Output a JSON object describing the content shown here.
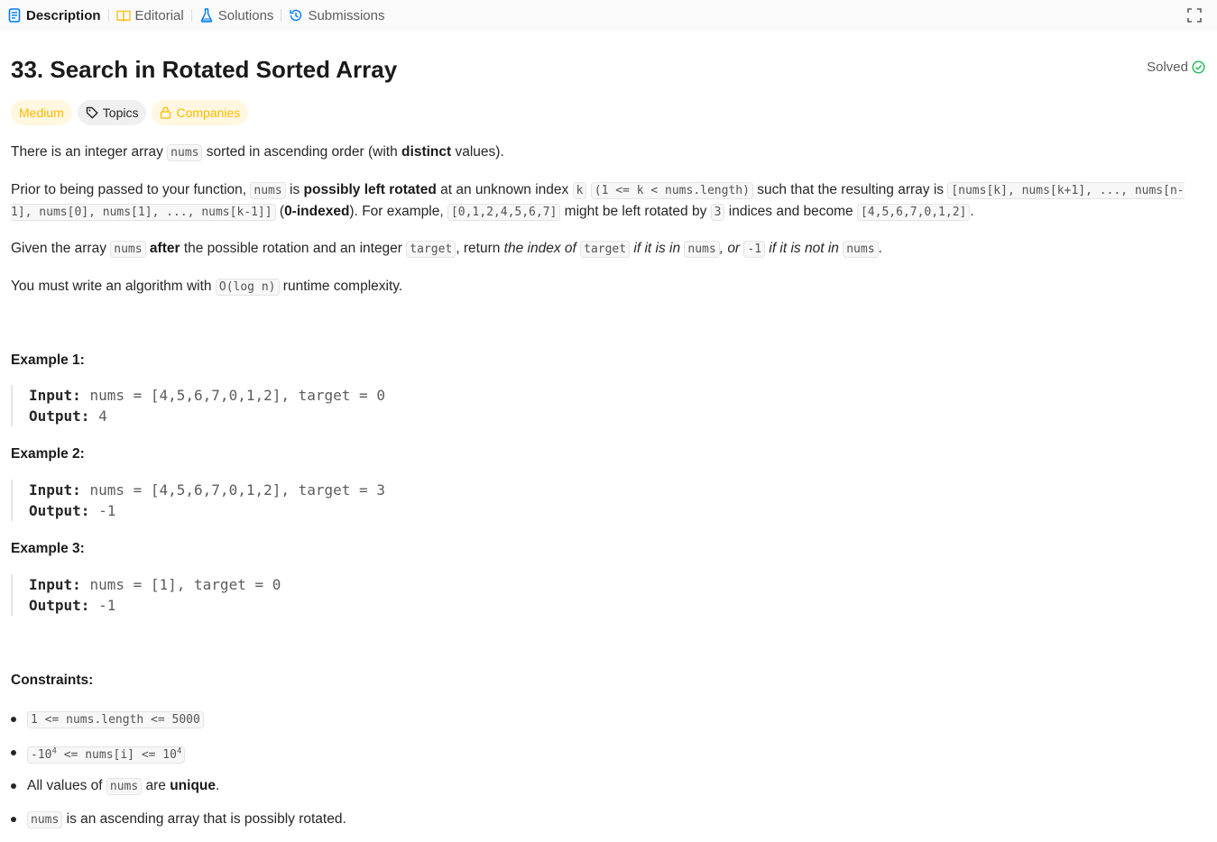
{
  "tabs": [
    {
      "label": "Description",
      "icon": "description-icon"
    },
    {
      "label": "Editorial",
      "icon": "book-icon"
    },
    {
      "label": "Solutions",
      "icon": "flask-icon"
    },
    {
      "label": "Submissions",
      "icon": "history-icon"
    }
  ],
  "problem": {
    "title": "33. Search in Rotated Sorted Array",
    "status": "Solved",
    "difficulty": "Medium",
    "topics_label": "Topics",
    "companies_label": "Companies"
  },
  "description": {
    "p1": {
      "a": "There is an integer array ",
      "code1": "nums",
      "b": " sorted in ascending order (with ",
      "bold": "distinct",
      "c": " values)."
    },
    "p2": {
      "a": "Prior to being passed to your function, ",
      "code1": "nums",
      "b": " is ",
      "bold1": "possibly left rotated",
      "c": " at an unknown index ",
      "code2": "k",
      "d": " ",
      "code3": "(1 <= k < nums.length)",
      "e": " such that the resulting array is ",
      "code4": "[nums[k], nums[k+1], ..., nums[n-1], nums[0], nums[1], ..., nums[k-1]]",
      "f": " (",
      "bold2": "0-indexed",
      "g": "). For example, ",
      "code5": "[0,1,2,4,5,6,7]",
      "h": " might be left rotated by ",
      "code6": "3",
      "i": " indices and become ",
      "code7": "[4,5,6,7,0,1,2]",
      "j": "."
    },
    "p3": {
      "a": "Given the array ",
      "code1": "nums",
      "b": " ",
      "bold": "after",
      "c": " the possible rotation and an integer ",
      "code2": "target",
      "d": ", return ",
      "em1": "the index of ",
      "code3": "target",
      "em2": " if it is in ",
      "code4": "nums",
      "em3": ", or ",
      "code5": "-1",
      "em4": " if it is not in ",
      "code6": "nums",
      "e": "."
    },
    "p4": {
      "a": "You must write an algorithm with ",
      "code1": "O(log n)",
      "b": " runtime complexity."
    }
  },
  "examples": [
    {
      "title": "Example 1:",
      "input_label": "Input:",
      "input": "nums = [4,5,6,7,0,1,2], target = 0",
      "output_label": "Output:",
      "output": "4"
    },
    {
      "title": "Example 2:",
      "input_label": "Input:",
      "input": "nums = [4,5,6,7,0,1,2], target = 3",
      "output_label": "Output:",
      "output": "-1"
    },
    {
      "title": "Example 3:",
      "input_label": "Input:",
      "input": "nums = [1], target = 0",
      "output_label": "Output:",
      "output": "-1"
    }
  ],
  "constraints": {
    "title": "Constraints:",
    "c1": "1 <= nums.length <= 5000",
    "c2": {
      "a": "-10",
      "sup1": "4",
      "b": " <= nums[i] <= 10",
      "sup2": "4"
    },
    "c3": {
      "a": "All values of ",
      "code": "nums",
      "b": " are ",
      "bold": "unique",
      "c": "."
    },
    "c4": {
      "code": "nums",
      "a": " is an ascending array that is possibly rotated."
    }
  }
}
